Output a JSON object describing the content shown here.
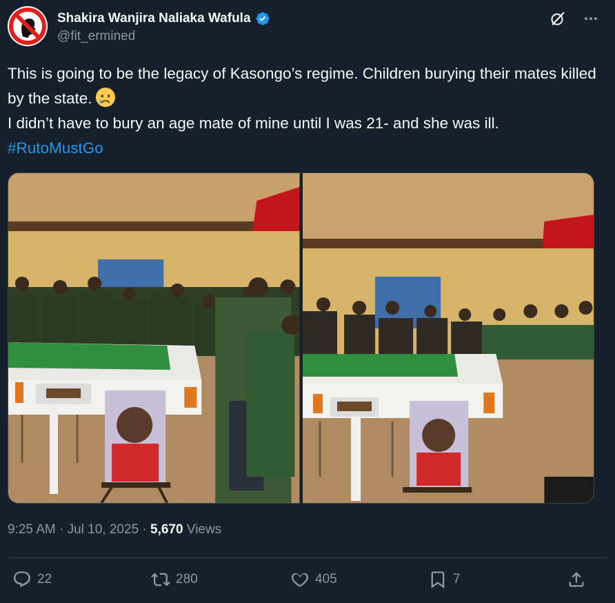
{
  "author": {
    "display_name": "Shakira Wanjira Naliaka Wafula",
    "handle": "@fit_ermined"
  },
  "post": {
    "line1": "This is going to be the legacy of Kasongo’s regime. Children burying their mates killed by the state.",
    "line2": "I didn’t have to bury an age mate of mine until I was 21- and she was ill.",
    "hashtag": "#RutoMustGo"
  },
  "meta": {
    "time": "9:25 AM",
    "separator": "·",
    "date": "Jul 10, 2025",
    "views_count": "5,670",
    "views_label": "Views"
  },
  "actions": {
    "replies": "22",
    "reposts": "280",
    "likes": "405",
    "bookmarks": "7"
  },
  "colors": {
    "background": "#15202b",
    "text_primary": "#f7f9f9",
    "text_secondary": "#8b98a5",
    "link": "#1d9bf0",
    "verified": "#1d9bf0",
    "divider": "#38444d"
  },
  "icons": [
    "no-symbol-avatar-icon",
    "verified-badge-icon",
    "grok-icon",
    "more-icon",
    "crying-face-icon",
    "reply-icon",
    "repost-icon",
    "like-icon",
    "bookmark-icon",
    "share-icon"
  ]
}
